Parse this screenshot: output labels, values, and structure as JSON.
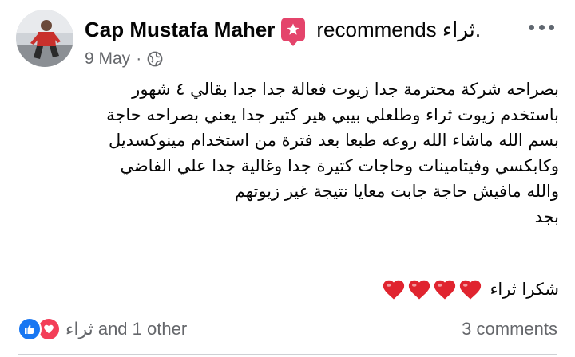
{
  "post": {
    "author_name": "Cap Mustafa Maher",
    "recommends_text": "recommends ثراء.",
    "date": "9 May",
    "privacy_icon": "globe-icon",
    "body_lines": [
      "بصراحه شركة محترمة جدا زيوت فعالة جدا جدا بقالي ٤ شهور",
      "باستخدم زيوت ثراء وطلعلي بيبي هير كتير جدا يعني بصراحه حاجة",
      "بسم الله ماشاء الله روعه  طبعا بعد فترة من استخدام مينوكسديل",
      "وكابكسي وفيتامينات وحاجات كتيرة جدا وغالية جدا علي الفاضي",
      "والله مافيش حاجة جابت معايا نتيجة غير زيوتهم",
      "بجد"
    ],
    "thanks_text": "شكرا ثراء",
    "heart_count": 4,
    "heart_color": "#e0242f"
  },
  "footer": {
    "reactions_text": "ثراء and 1 other",
    "comments_text": "3 comments",
    "like_color": "#1877f2",
    "love_color": "#f33e58"
  }
}
